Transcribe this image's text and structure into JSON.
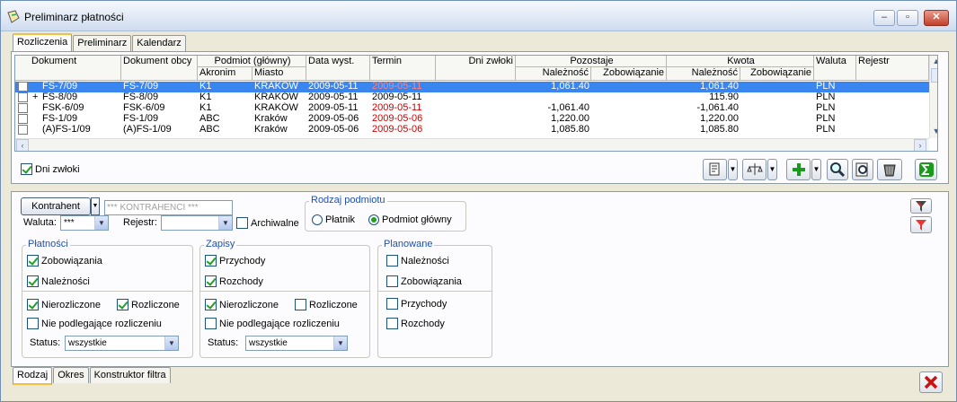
{
  "window": {
    "title": "Preliminarz płatności"
  },
  "top_tabs": [
    {
      "label": "Rozliczenia",
      "active": true
    },
    {
      "label": "Preliminarz",
      "active": false
    },
    {
      "label": "Kalendarz",
      "active": false
    }
  ],
  "grid": {
    "headers": {
      "dokument": "Dokument",
      "dokument_obcy": "Dokument obcy",
      "podmiot": "Podmiot (główny)",
      "akronim": "Akronim",
      "miasto": "Miasto",
      "data_wyst": "Data wyst.",
      "termin": "Termin",
      "dni_zwloki": "Dni zwłoki",
      "pozostaje": "Pozostaje",
      "pozostaje_naleznosc": "Należność",
      "pozostaje_zobowiazanie": "Zobowiązanie",
      "kwota": "Kwota",
      "kwota_naleznosc": "Należność",
      "kwota_zobowiazanie": "Zobowiązanie",
      "waluta": "Waluta",
      "rejestr": "Rejestr"
    },
    "rows": [
      {
        "expand": "",
        "dokument": "FS-7/09",
        "obcy": "FS-7/09",
        "akronim": "K1",
        "miasto": "KRAKÓW",
        "data": "2009-05-11",
        "termin": "2009-05-11",
        "termin_overdue": true,
        "poz_nal": "1,061.40",
        "poz_zob": "",
        "kw_nal": "1,061.40",
        "kw_zob": "",
        "waluta": "PLN",
        "selected": true
      },
      {
        "expand": "+",
        "dokument": "FS-8/09",
        "obcy": "FS-8/09",
        "akronim": "K1",
        "miasto": "KRAKÓW",
        "data": "2009-05-11",
        "termin": "2009-05-11",
        "termin_overdue": false,
        "poz_nal": "",
        "poz_zob": "",
        "kw_nal": "115.90",
        "kw_zob": "",
        "waluta": "PLN",
        "selected": false
      },
      {
        "expand": "",
        "dokument": "FSK-6/09",
        "obcy": "FSK-6/09",
        "akronim": "K1",
        "miasto": "KRAKÓW",
        "data": "2009-05-11",
        "termin": "2009-05-11",
        "termin_overdue": true,
        "poz_nal": "-1,061.40",
        "poz_zob": "",
        "kw_nal": "-1,061.40",
        "kw_zob": "",
        "waluta": "PLN",
        "selected": false
      },
      {
        "expand": "",
        "dokument": "FS-1/09",
        "obcy": "FS-1/09",
        "akronim": "ABC",
        "miasto": "Kraków",
        "data": "2009-05-06",
        "termin": "2009-05-06",
        "termin_overdue": true,
        "poz_nal": "1,220.00",
        "poz_zob": "",
        "kw_nal": "1,220.00",
        "kw_zob": "",
        "waluta": "PLN",
        "selected": false
      },
      {
        "expand": "",
        "dokument": "(A)FS-1/09",
        "obcy": "(A)FS-1/09",
        "akronim": "ABC",
        "miasto": "Kraków",
        "data": "2009-05-06",
        "termin": "2009-05-06",
        "termin_overdue": true,
        "poz_nal": "1,085.80",
        "poz_zob": "",
        "kw_nal": "1,085.80",
        "kw_zob": "",
        "waluta": "PLN",
        "selected": false
      }
    ]
  },
  "dni_zwloki_checkbox": {
    "label": "Dni zwłoki",
    "checked": true
  },
  "toolbar_icons": [
    "print-icon",
    "compare-icon",
    "add-icon",
    "search-icon",
    "zoom-icon",
    "delete-icon",
    "sum-icon"
  ],
  "filter": {
    "kontrahent_button": "Kontrahent",
    "kontrahent_value": "*** KONTRAHENCI ***",
    "waluta_label": "Waluta:",
    "waluta_value": "***",
    "rejestr_label": "Rejestr:",
    "rejestr_value": "",
    "archiwalne": {
      "label": "Archiwalne",
      "checked": false
    },
    "rodzaj_podmiotu": {
      "title": "Rodzaj podmiotu",
      "platnik": "Płatnik",
      "podmiot_glowny": "Podmiot główny",
      "selected": "podmiot_glowny"
    },
    "platnosci": {
      "title": "Płatności",
      "zobowiazania": "Zobowiązania",
      "naleznosci": "Należności",
      "nierozliczone": "Nierozliczone",
      "rozliczone": "Rozliczone",
      "nie_podlegajace": "Nie podlegające rozliczeniu",
      "status_label": "Status:",
      "status_value": "wszystkie"
    },
    "zapisy": {
      "title": "Zapisy",
      "przychody": "Przychody",
      "rozchody": "Rozchody",
      "nierozliczone": "Nierozliczone",
      "rozliczone": "Rozliczone",
      "nie_podlegajace": "Nie podlegające rozliczeniu",
      "status_label": "Status:",
      "status_value": "wszystkie"
    },
    "planowane": {
      "title": "Planowane",
      "naleznosci": "Należności",
      "zobowiazania": "Zobowiązania",
      "przychody": "Przychody",
      "rozchody": "Rozchody"
    }
  },
  "bottom_tabs": [
    {
      "label": "Rodzaj",
      "active": true
    },
    {
      "label": "Okres",
      "active": false
    },
    {
      "label": "Konstruktor filtra",
      "active": false
    }
  ],
  "colors": {
    "selection": "#3a86f0",
    "overdue": "#d00000",
    "group_title": "#1f4fb0"
  }
}
